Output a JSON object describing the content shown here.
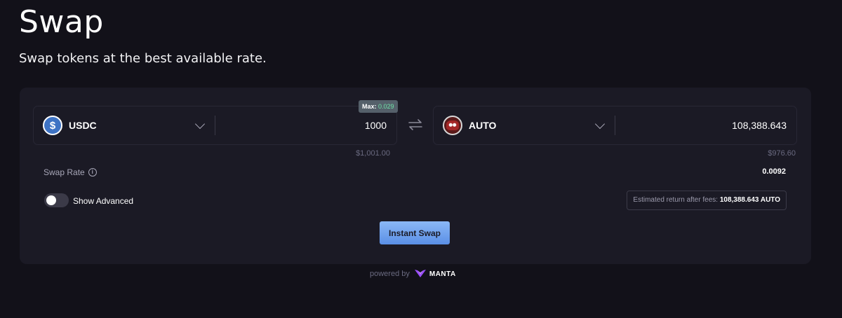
{
  "header": {
    "title": "Swap",
    "subtitle": "Swap tokens at the best available rate."
  },
  "from_token": {
    "symbol": "USDC",
    "icon": "usdc-icon",
    "amount": "1000",
    "usd_value": "$1,001.00",
    "max_label": "Max:",
    "max_value": "0.029"
  },
  "to_token": {
    "symbol": "AUTO",
    "icon": "auto-icon",
    "amount": "108,388.643",
    "usd_value": "$976.60"
  },
  "swap_rate": {
    "label": "Swap Rate",
    "value": "0.0092"
  },
  "advanced": {
    "label": "Show Advanced",
    "enabled": false
  },
  "estimate": {
    "label": "Estimated return after fees:",
    "amount": "108,388.643 AUTO"
  },
  "actions": {
    "instant_swap": "Instant Swap"
  },
  "footer": {
    "powered_by": "powered by",
    "brand": "MANTA"
  },
  "colors": {
    "background": "#121119",
    "card": "#1b1a25",
    "accent": "#6f9ff0",
    "max_value": "#6fe3a8",
    "manta_logo": "#9b4dff"
  }
}
